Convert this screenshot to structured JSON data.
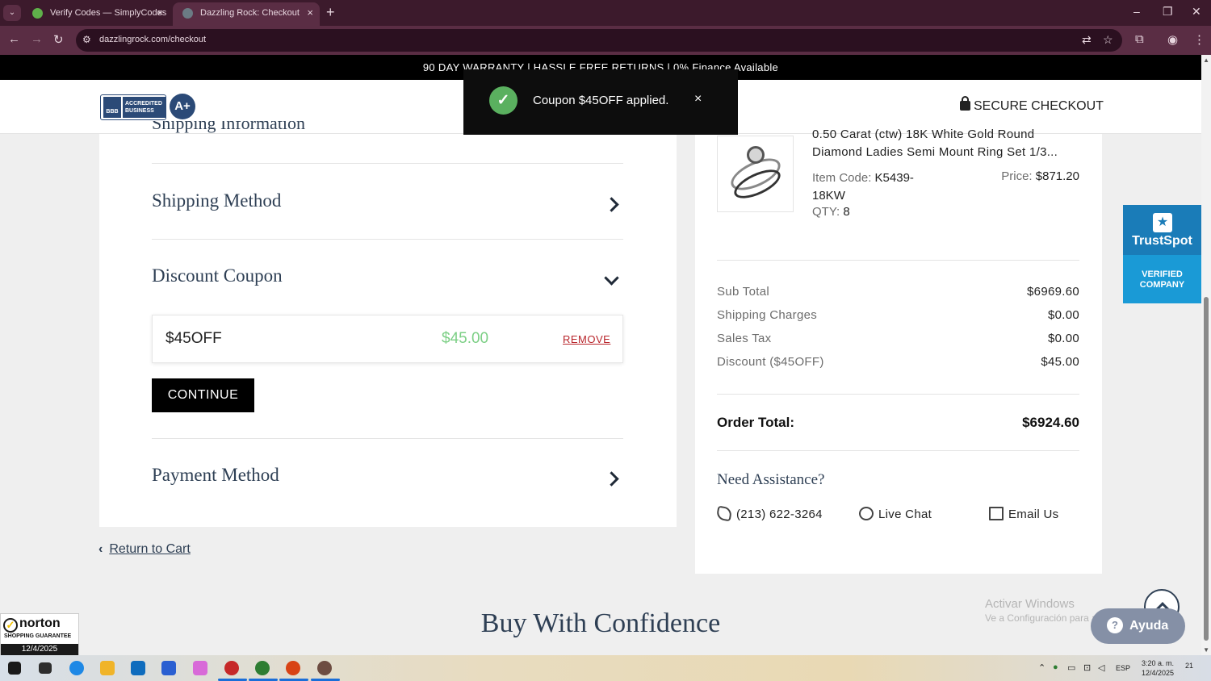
{
  "browser": {
    "tabs": [
      {
        "title": "Verify Codes — SimplyCodes",
        "active": false,
        "favicon_color": "#5fb04a"
      },
      {
        "title": "Dazzling Rock: Checkout",
        "active": true,
        "favicon_color": "#6b7b84"
      }
    ],
    "url": "dazzlingrock.com/checkout"
  },
  "promo_bar": "90 DAY WARRANTY | HASSLE FREE RETURNS | 0% Finance Available",
  "header": {
    "bbb_logo": "BBB",
    "bbb_badge": "ACCREDITED BUSINESS",
    "bbb_grade": "A+",
    "secure_checkout": "SECURE CHECKOUT"
  },
  "toast": {
    "message": "Coupon $45OFF applied.",
    "close": "×"
  },
  "checkout": {
    "clipped_title": "Shipping Information",
    "shipping_method": "Shipping Method",
    "discount_coupon": "Discount Coupon",
    "coupon": {
      "code": "$45OFF",
      "amount": "$45.00",
      "remove": "REMOVE"
    },
    "continue": "CONTINUE",
    "payment_method": "Payment Method",
    "return_to_cart": "Return to Cart"
  },
  "order": {
    "product_title_line1": "0.50 Carat (ctw) 18K White Gold Round",
    "product_title_line2": "Diamond Ladies Semi Mount Ring Set 1/3...",
    "item_code_label": "Item Code:",
    "item_code": "K5439-18KW",
    "price_label": "Price:",
    "price": "$871.20",
    "qty_label": "QTY:",
    "qty": "8",
    "summary": [
      {
        "label": "Sub Total",
        "value": "$6969.60"
      },
      {
        "label": "Shipping Charges",
        "value": "$0.00"
      },
      {
        "label": "Sales Tax",
        "value": "$0.00"
      },
      {
        "label": "Discount ($45OFF)",
        "value": "$45.00"
      }
    ],
    "total_label": "Order Total:",
    "total_value": "$6924.60"
  },
  "assistance": {
    "title": "Need Assistance?",
    "phone": "(213) 622-3264",
    "chat": "Live Chat",
    "email": "Email Us"
  },
  "trustspot": {
    "name": "TrustSpot",
    "line1": "VERIFIED",
    "line2": "COMPANY"
  },
  "buy_with_confidence": "Buy With Confidence",
  "windows_watermark": {
    "line1": "Activar Windows",
    "line2": "Ve a Configuración para activar Windows."
  },
  "ayuda": "Ayuda",
  "norton": {
    "name": "norton",
    "sub": "SHOPPING GUARANTEE",
    "date": "12/4/2025"
  },
  "taskbar": {
    "lang": "ESP",
    "time": "3:20 a. m.",
    "date": "12/4/2025",
    "notifications": "21"
  },
  "colors": {
    "accent_green": "#5ab05f",
    "coupon_amount": "#7ccf85",
    "remove_red": "#b8242a",
    "heading_navy": "#2e3f54"
  }
}
